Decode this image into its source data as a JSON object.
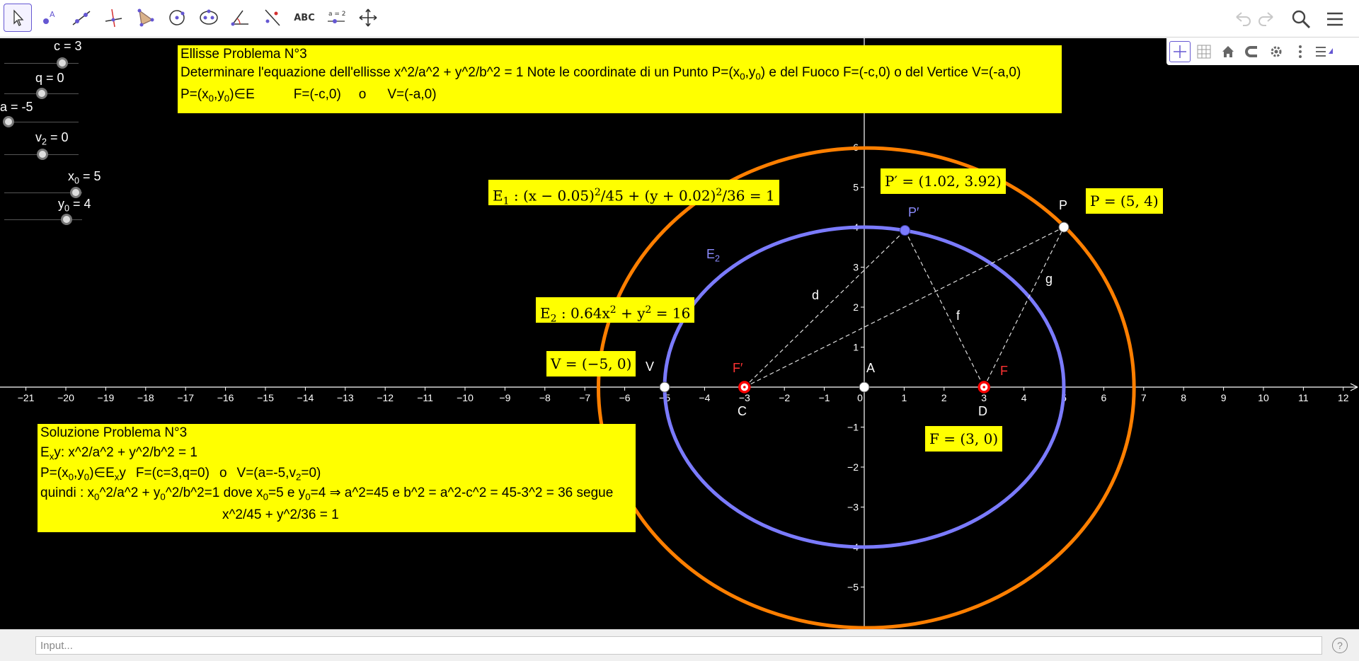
{
  "toolbar": {
    "tools": [
      "move-tool",
      "point-tool",
      "line-tool",
      "perpendicular-tool",
      "polygon-tool",
      "circle-tool",
      "conic-tool",
      "angle-tool",
      "reflect-tool",
      "text-tool",
      "slider-tool",
      "move-graphics-tool"
    ],
    "text_tool_label": "ABC",
    "slider_tool_label": "a = 2"
  },
  "panel_top": {
    "title": "Ellisse Problema N°3",
    "line2_a": "Determinare l'equazione dell'ellisse x^2/a^2 + y^2/b^2 = 1 Note le coordinate di un Punto P=(x",
    "line2_b": ",y",
    "line2_c": ") e del Fuoco F=(-c,0) o del Vertice V=(-a,0)",
    "line3_a": "P=(x",
    "line3_b": ",y",
    "line3_c": ")∈E",
    "line3_d": "F=(-c,0)",
    "line3_e": "o",
    "line3_f": "V=(-a,0)",
    "sub0": "0"
  },
  "panel_bottom": {
    "title": "Soluzione Problema N°3",
    "l2_a": "E",
    "l2_sub": "x",
    "l2_b": "y: x^2/a^2 + y^2/b^2 = 1",
    "l3_a": "P=(x",
    "l3_b": ",y",
    "l3_c": ")∈E",
    "l3_d": "y",
    "l3_e": "F=(c=3,q=0)",
    "l3_f": "o",
    "l3_g": "V=(a=-5,v",
    "l3_h": "=0)",
    "l4_a": "quindi : x",
    "l4_b": "^2/a^2 + y",
    "l4_c": "^2/b^2=1 dove x",
    "l4_d": "=5 e y",
    "l4_e": "=4 ⇒ a^2=45 e b^2 = a^2-c^2 = 45-3^2 = 36 segue",
    "l5": "x^2/45 + y^2/36 = 1",
    "sub0": "0",
    "sub2": "2"
  },
  "sliders": [
    {
      "name": "c",
      "text": "c = 3"
    },
    {
      "name": "q",
      "text": "q = 0"
    },
    {
      "name": "a",
      "text": "a = -5"
    },
    {
      "name": "v2",
      "text_a": "v",
      "text_sub": "2",
      "text_b": " = 0"
    },
    {
      "name": "x0",
      "text_a": "x",
      "text_sub": "0",
      "text_b": " = 5"
    },
    {
      "name": "y0",
      "text_a": "y",
      "text_sub": "0",
      "text_b": " = 4"
    }
  ],
  "labels": {
    "E1_a": "E",
    "E1_sub": "1",
    "E1_b": " :  (x − 0.05)",
    "E1_c": "/45 + (y + 0.02)",
    "E1_d": "/36 = 1",
    "E2_a": "E",
    "E2_sub": "2",
    "E2_b": " :  0.64x",
    "E2_c": " + y",
    "E2_d": " = 16",
    "sup2": "2",
    "Pprime_value": "P′ = (1.02, 3.92)",
    "P_value": "P = (5, 4)",
    "V_value": "V = (−5, 0)",
    "F_value": "F = (3, 0)"
  },
  "points": {
    "P": "P",
    "Pprime": "P′",
    "V": "V",
    "A": "A",
    "C": "C",
    "D": "D",
    "F": "F",
    "Fprime": "F′",
    "E2_name": "E",
    "E2_sub": "2",
    "d": "d",
    "f": "f",
    "g": "g"
  },
  "axes": {
    "x_ticks": [
      -21,
      -20,
      -19,
      -18,
      -17,
      -16,
      -15,
      -14,
      -13,
      -12,
      -11,
      -10,
      -9,
      -8,
      -7,
      -6,
      -5,
      -4,
      -3,
      -2,
      -1,
      0,
      1,
      2,
      3,
      4,
      5,
      6,
      7,
      8,
      9,
      10,
      11,
      12
    ],
    "y_ticks": [
      -5,
      -4,
      -3,
      -2,
      -1,
      1,
      2,
      3,
      4,
      5,
      6
    ]
  },
  "input": {
    "placeholder": "Input..."
  },
  "help_label": "?",
  "colors": {
    "background": "#000000",
    "panel": "#ffff00",
    "ellipse1": "#ff7f00",
    "ellipse2": "#7b7bff",
    "focus": "#ff0000",
    "point_label_red": "#ff3333",
    "accent": "#6557d2"
  }
}
